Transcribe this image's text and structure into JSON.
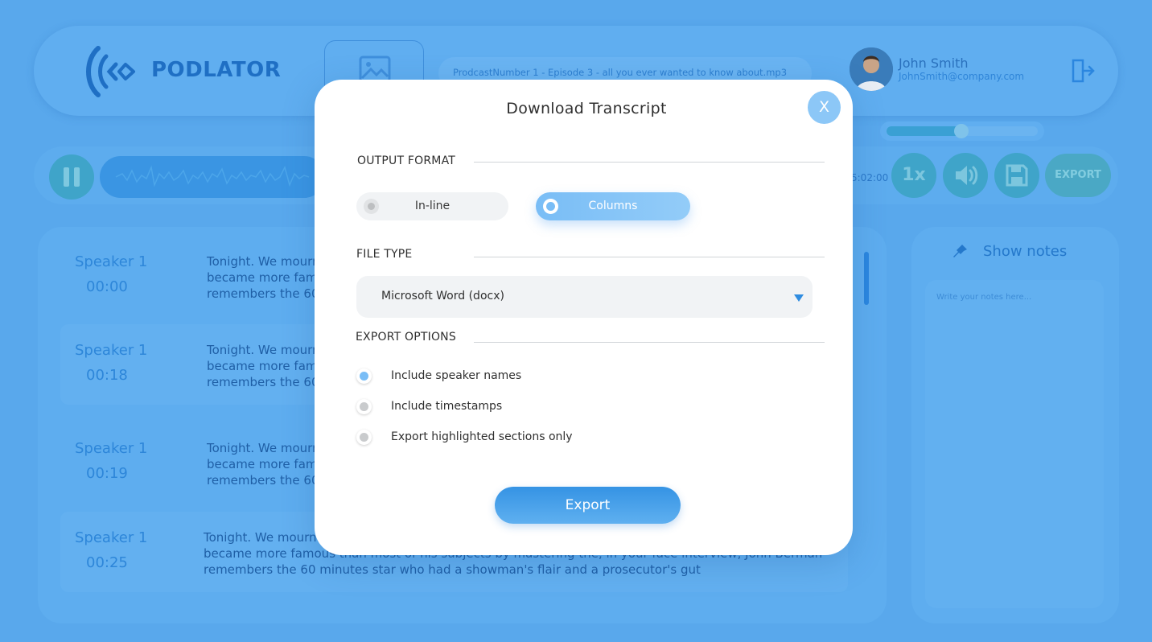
{
  "header": {
    "logo_text": "PODLATOR",
    "file_name": "ProdcastNumber 1 - Episode 3 - all you ever wanted to know about.mp3",
    "user": {
      "name": "John Smith",
      "email": "JohnSmith@company.com"
    }
  },
  "player": {
    "time": "5:02:00",
    "speed_label": "1x",
    "export_label": "EXPORT",
    "volume_fraction": 0.5
  },
  "transcript": {
    "entries": [
      {
        "speaker": "Speaker 1",
        "time": "00:00",
        "line1": "Tonight. We mourn the passing of 60 minutes correspondent Mike Wallace, who for decades",
        "line2": "became more famous than most of his subjects by mastering the",
        "line3": "remembers the 60 minutes star who had a showman's flair and a prosecutor's gut"
      },
      {
        "speaker": "Speaker 1",
        "time": "00:18",
        "line1": "Tonight. We mourn the passing of 60 minutes correspondent Mike Wallace, who for decades",
        "line2": "became more famous than most of his subjects by mastering the",
        "line3": "remembers the 60 minutes star who had a showman's flair and a prosecutor's gut"
      },
      {
        "speaker": "Speaker 1",
        "time": "00:19",
        "line1": "Tonight. We mourn the passing of 60 minutes correspondent Mike Wallace, who for decades",
        "line2": "became more famous than most of his subjects by mastering the",
        "line3": "remembers the 60 minutes star who had a showman's flair and a prosecutor's gut"
      },
      {
        "speaker": "Speaker 1",
        "time": "00:25",
        "line1": "Tonight. We mourn",
        "line2": "became more famous than most of his subjects by mastering the, in your face interview, John Berman",
        "line3": "remembers the 60 minutes star who had a showman's flair and a prosecutor's gut"
      }
    ]
  },
  "notes": {
    "title": "Show notes",
    "placeholder": "Write your notes here..."
  },
  "modal": {
    "title": "Download Transcript",
    "close_label": "X",
    "output_format": {
      "label": "OUTPUT FORMAT",
      "options": [
        "In-line",
        "Columns"
      ],
      "selected": "Columns"
    },
    "file_type": {
      "label": "FILE TYPE",
      "selected": "Microsoft Word (docx)"
    },
    "export_options": {
      "label": "EXPORT OPTIONS",
      "items": [
        {
          "label": "Include speaker names",
          "checked": true
        },
        {
          "label": "Include timestamps",
          "checked": false
        },
        {
          "label": "Export highlighted sections only",
          "checked": false
        }
      ]
    },
    "export_button": "Export"
  },
  "colors": {
    "background": "#59a8ec",
    "accent": "#79bdf6",
    "primary_button": "#3593e4",
    "modal_bg": "#ffffff"
  },
  "icons": [
    "logo-icon",
    "image-icon",
    "logout-icon",
    "pause-icon",
    "volume-icon",
    "save-icon",
    "pin-icon",
    "close-icon",
    "dropdown-caret-icon"
  ]
}
